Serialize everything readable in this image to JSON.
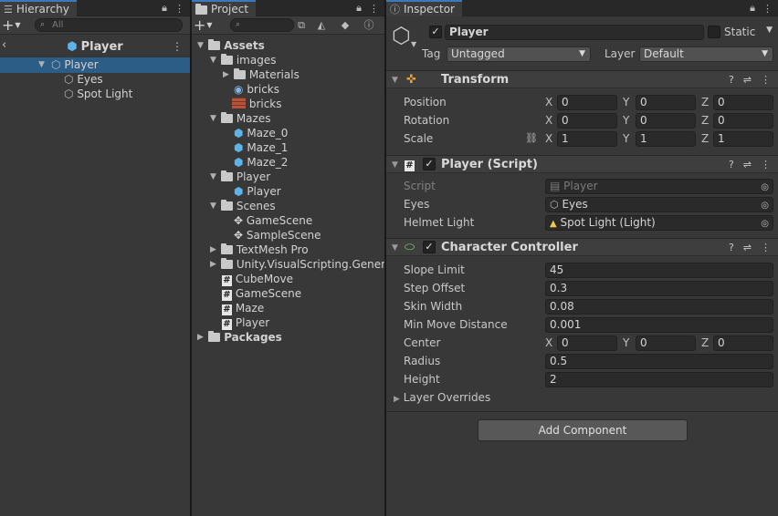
{
  "hierarchy": {
    "tab_label": "Hierarchy",
    "search_placeholder": "All",
    "scene_title": "Player",
    "items": [
      {
        "label": "Player"
      },
      {
        "label": "Eyes"
      },
      {
        "label": "Spot Light"
      }
    ]
  },
  "project": {
    "tab_label": "Project",
    "tree": {
      "assets": "Assets",
      "images": "images",
      "materials": "Materials",
      "bricks_material": "bricks",
      "bricks_texture": "bricks",
      "mazes": "Mazes",
      "maze0": "Maze_0",
      "maze1": "Maze_1",
      "maze2": "Maze_2",
      "player_folder": "Player",
      "player_prefab": "Player",
      "scenes": "Scenes",
      "game_scene": "GameScene",
      "sample_scene": "SampleScene",
      "textmesh": "TextMesh Pro",
      "visual_scripting": "Unity.VisualScripting.Genera",
      "cube_move": "CubeMove",
      "game_scene_script": "GameScene",
      "maze_script": "Maze",
      "player_script": "Player",
      "packages": "Packages"
    }
  },
  "inspector": {
    "tab_label": "Inspector",
    "object_name": "Player",
    "static_label": "Static",
    "tag_label": "Tag",
    "tag_value": "Untagged",
    "layer_label": "Layer",
    "layer_value": "Default",
    "transform": {
      "title": "Transform",
      "position_label": "Position",
      "rotation_label": "Rotation",
      "scale_label": "Scale",
      "axis_x": "X",
      "axis_y": "Y",
      "axis_z": "Z",
      "position": {
        "x": "0",
        "y": "0",
        "z": "0"
      },
      "rotation": {
        "x": "0",
        "y": "0",
        "z": "0"
      },
      "scale": {
        "x": "1",
        "y": "1",
        "z": "1"
      }
    },
    "player_script": {
      "title": "Player (Script)",
      "script_label": "Script",
      "script_value": "Player",
      "eyes_label": "Eyes",
      "eyes_value": "Eyes",
      "helmet_label": "Helmet Light",
      "helmet_value": "Spot Light (Light)"
    },
    "character_controller": {
      "title": "Character Controller",
      "slope_label": "Slope Limit",
      "slope_value": "45",
      "step_label": "Step Offset",
      "step_value": "0.3",
      "skin_label": "Skin Width",
      "skin_value": "0.08",
      "minmove_label": "Min Move Distance",
      "minmove_value": "0.001",
      "center_label": "Center",
      "center": {
        "x": "0",
        "y": "0",
        "z": "0"
      },
      "radius_label": "Radius",
      "radius_value": "0.5",
      "height_label": "Height",
      "height_value": "2",
      "layer_overrides_label": "Layer Overrides"
    },
    "add_component_label": "Add Component"
  },
  "colors": {
    "selection": "#2c5d87",
    "tab_accent": "#3a79bb",
    "prefab_blue": "#5cb4e8"
  }
}
